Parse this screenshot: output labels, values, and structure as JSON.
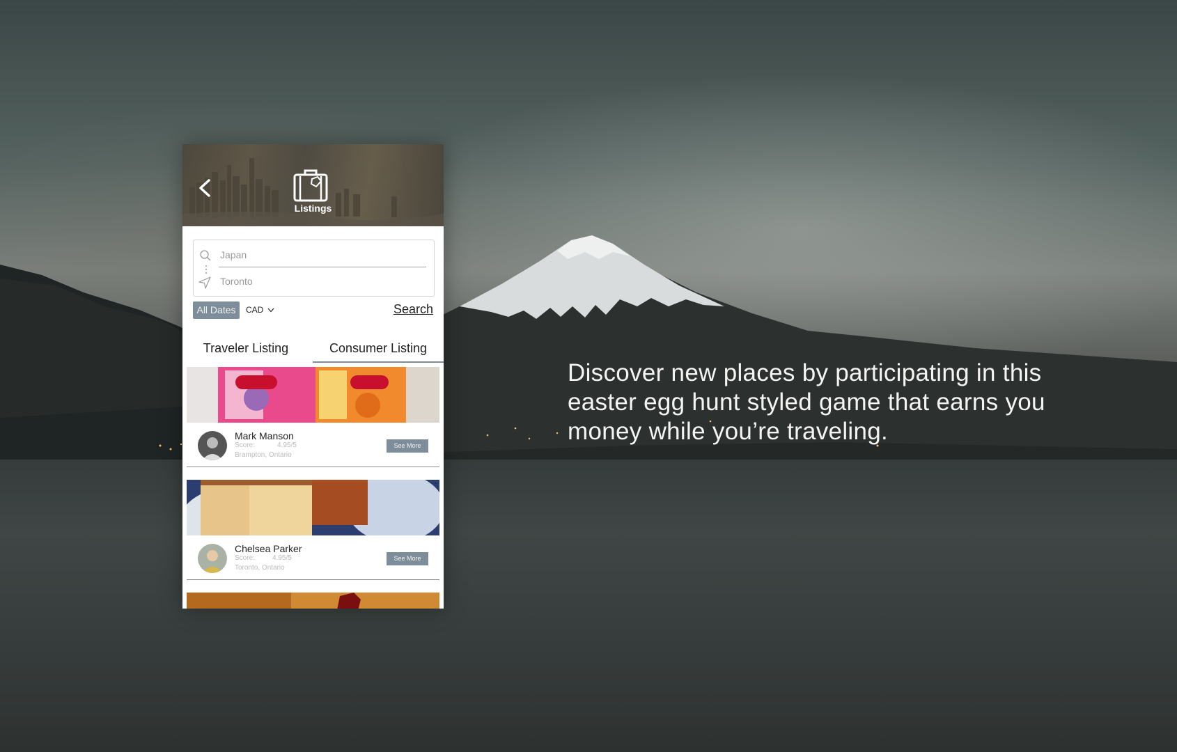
{
  "caption": "Discover new places by participating in this easter egg hunt styled game that earns you money while you’re traveling.",
  "app": {
    "title": "Listings",
    "search": {
      "destination_value": "Japan",
      "origin_value": "Toronto"
    },
    "filters": {
      "dates_label": "All Dates",
      "currency_label": "CAD",
      "search_label": "Search"
    },
    "tabs": [
      {
        "label": "Traveler Listing",
        "active": false
      },
      {
        "label": "Consumer Listing",
        "active": true
      }
    ],
    "listings": [
      {
        "name": "Mark Manson",
        "score_label": "Score:",
        "score": "4.95/5",
        "location": "Brampton, Ontario",
        "button": "See More"
      },
      {
        "name": "Chelsea Parker",
        "score_label": "Score:",
        "score": "4.95/5",
        "location": "Toronto, Ontario",
        "button": "See More"
      }
    ]
  },
  "colors": {
    "accent": "#7d8d99",
    "background": "#3a403f",
    "card": "#ffffff"
  }
}
